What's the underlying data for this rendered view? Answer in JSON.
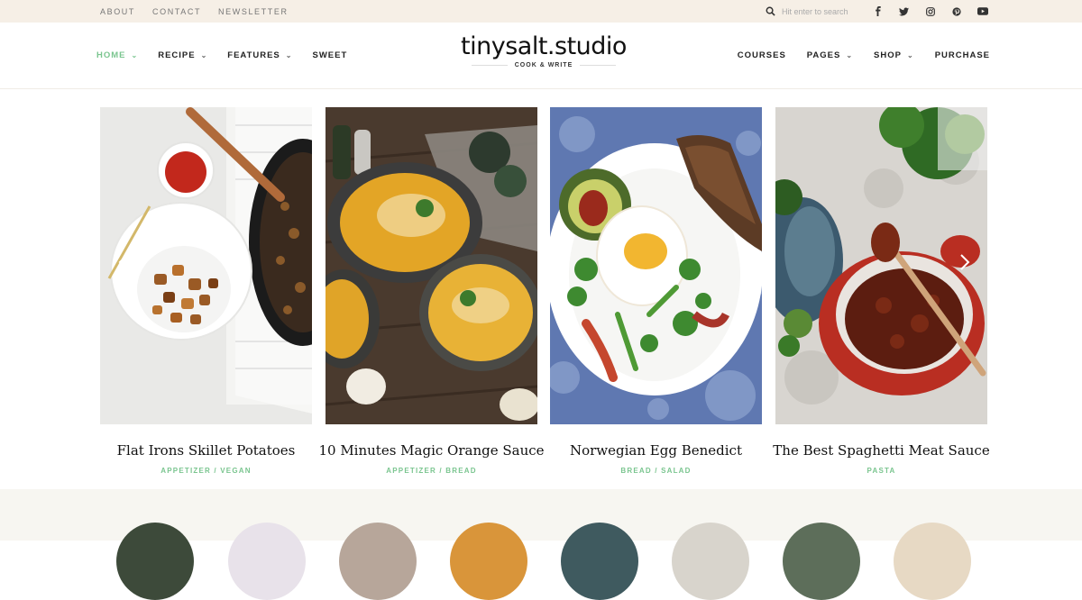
{
  "topbar": {
    "links": [
      "ABOUT",
      "CONTACT",
      "NEWSLETTER"
    ],
    "search_placeholder": "Hit enter to search",
    "social_icons": [
      "facebook-icon",
      "twitter-icon",
      "instagram-icon",
      "pinterest-icon",
      "youtube-icon"
    ]
  },
  "header": {
    "nav_left": [
      {
        "label": "HOME",
        "dropdown": true,
        "active": true
      },
      {
        "label": "RECIPE",
        "dropdown": true
      },
      {
        "label": "FEATURES",
        "dropdown": true
      },
      {
        "label": "SWEET",
        "dropdown": false
      }
    ],
    "logo": "tinysalt.studio",
    "tagline": "COOK & WRITE",
    "nav_right": [
      {
        "label": "COURSES",
        "dropdown": false
      },
      {
        "label": "PAGES",
        "dropdown": true
      },
      {
        "label": "SHOP",
        "dropdown": true
      },
      {
        "label": "PURCHASE",
        "dropdown": false
      }
    ]
  },
  "posts": [
    {
      "title": "Flat Irons Skillet Potatoes",
      "category": "APPETIZER / VEGAN"
    },
    {
      "title": "10 Minutes Magic Orange Sauce",
      "category": "APPETIZER / BREAD"
    },
    {
      "title": "Norwegian Egg Benedict",
      "category": "BREAD / SALAD"
    },
    {
      "title": "The Best Spaghetti Meat Sauce",
      "category": "PASTA"
    }
  ],
  "colors": {
    "accent": "#7ac58f",
    "topbar_bg": "#f6efe6",
    "section_bg": "#f7f6f1"
  }
}
